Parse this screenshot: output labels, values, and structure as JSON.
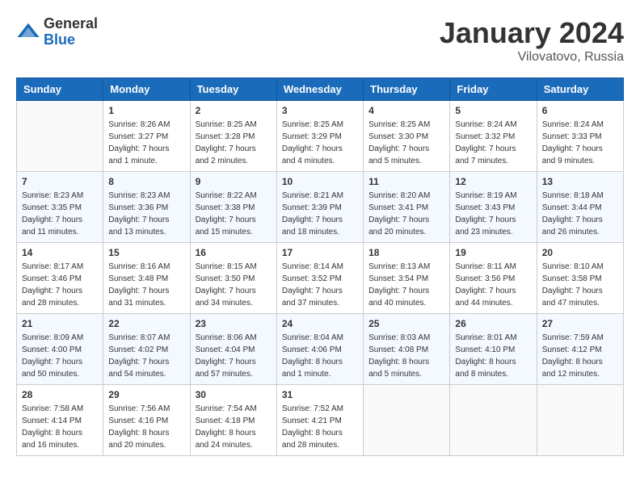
{
  "header": {
    "logo_general": "General",
    "logo_blue": "Blue",
    "month": "January 2024",
    "location": "Vilovatovo, Russia"
  },
  "weekdays": [
    "Sunday",
    "Monday",
    "Tuesday",
    "Wednesday",
    "Thursday",
    "Friday",
    "Saturday"
  ],
  "weeks": [
    [
      {
        "day": "",
        "empty": true
      },
      {
        "day": "1",
        "sunrise": "Sunrise: 8:26 AM",
        "sunset": "Sunset: 3:27 PM",
        "daylight": "Daylight: 7 hours and 1 minute."
      },
      {
        "day": "2",
        "sunrise": "Sunrise: 8:25 AM",
        "sunset": "Sunset: 3:28 PM",
        "daylight": "Daylight: 7 hours and 2 minutes."
      },
      {
        "day": "3",
        "sunrise": "Sunrise: 8:25 AM",
        "sunset": "Sunset: 3:29 PM",
        "daylight": "Daylight: 7 hours and 4 minutes."
      },
      {
        "day": "4",
        "sunrise": "Sunrise: 8:25 AM",
        "sunset": "Sunset: 3:30 PM",
        "daylight": "Daylight: 7 hours and 5 minutes."
      },
      {
        "day": "5",
        "sunrise": "Sunrise: 8:24 AM",
        "sunset": "Sunset: 3:32 PM",
        "daylight": "Daylight: 7 hours and 7 minutes."
      },
      {
        "day": "6",
        "sunrise": "Sunrise: 8:24 AM",
        "sunset": "Sunset: 3:33 PM",
        "daylight": "Daylight: 7 hours and 9 minutes."
      }
    ],
    [
      {
        "day": "7",
        "sunrise": "Sunrise: 8:23 AM",
        "sunset": "Sunset: 3:35 PM",
        "daylight": "Daylight: 7 hours and 11 minutes."
      },
      {
        "day": "8",
        "sunrise": "Sunrise: 8:23 AM",
        "sunset": "Sunset: 3:36 PM",
        "daylight": "Daylight: 7 hours and 13 minutes."
      },
      {
        "day": "9",
        "sunrise": "Sunrise: 8:22 AM",
        "sunset": "Sunset: 3:38 PM",
        "daylight": "Daylight: 7 hours and 15 minutes."
      },
      {
        "day": "10",
        "sunrise": "Sunrise: 8:21 AM",
        "sunset": "Sunset: 3:39 PM",
        "daylight": "Daylight: 7 hours and 18 minutes."
      },
      {
        "day": "11",
        "sunrise": "Sunrise: 8:20 AM",
        "sunset": "Sunset: 3:41 PM",
        "daylight": "Daylight: 7 hours and 20 minutes."
      },
      {
        "day": "12",
        "sunrise": "Sunrise: 8:19 AM",
        "sunset": "Sunset: 3:43 PM",
        "daylight": "Daylight: 7 hours and 23 minutes."
      },
      {
        "day": "13",
        "sunrise": "Sunrise: 8:18 AM",
        "sunset": "Sunset: 3:44 PM",
        "daylight": "Daylight: 7 hours and 26 minutes."
      }
    ],
    [
      {
        "day": "14",
        "sunrise": "Sunrise: 8:17 AM",
        "sunset": "Sunset: 3:46 PM",
        "daylight": "Daylight: 7 hours and 28 minutes."
      },
      {
        "day": "15",
        "sunrise": "Sunrise: 8:16 AM",
        "sunset": "Sunset: 3:48 PM",
        "daylight": "Daylight: 7 hours and 31 minutes."
      },
      {
        "day": "16",
        "sunrise": "Sunrise: 8:15 AM",
        "sunset": "Sunset: 3:50 PM",
        "daylight": "Daylight: 7 hours and 34 minutes."
      },
      {
        "day": "17",
        "sunrise": "Sunrise: 8:14 AM",
        "sunset": "Sunset: 3:52 PM",
        "daylight": "Daylight: 7 hours and 37 minutes."
      },
      {
        "day": "18",
        "sunrise": "Sunrise: 8:13 AM",
        "sunset": "Sunset: 3:54 PM",
        "daylight": "Daylight: 7 hours and 40 minutes."
      },
      {
        "day": "19",
        "sunrise": "Sunrise: 8:11 AM",
        "sunset": "Sunset: 3:56 PM",
        "daylight": "Daylight: 7 hours and 44 minutes."
      },
      {
        "day": "20",
        "sunrise": "Sunrise: 8:10 AM",
        "sunset": "Sunset: 3:58 PM",
        "daylight": "Daylight: 7 hours and 47 minutes."
      }
    ],
    [
      {
        "day": "21",
        "sunrise": "Sunrise: 8:09 AM",
        "sunset": "Sunset: 4:00 PM",
        "daylight": "Daylight: 7 hours and 50 minutes."
      },
      {
        "day": "22",
        "sunrise": "Sunrise: 8:07 AM",
        "sunset": "Sunset: 4:02 PM",
        "daylight": "Daylight: 7 hours and 54 minutes."
      },
      {
        "day": "23",
        "sunrise": "Sunrise: 8:06 AM",
        "sunset": "Sunset: 4:04 PM",
        "daylight": "Daylight: 7 hours and 57 minutes."
      },
      {
        "day": "24",
        "sunrise": "Sunrise: 8:04 AM",
        "sunset": "Sunset: 4:06 PM",
        "daylight": "Daylight: 8 hours and 1 minute."
      },
      {
        "day": "25",
        "sunrise": "Sunrise: 8:03 AM",
        "sunset": "Sunset: 4:08 PM",
        "daylight": "Daylight: 8 hours and 5 minutes."
      },
      {
        "day": "26",
        "sunrise": "Sunrise: 8:01 AM",
        "sunset": "Sunset: 4:10 PM",
        "daylight": "Daylight: 8 hours and 8 minutes."
      },
      {
        "day": "27",
        "sunrise": "Sunrise: 7:59 AM",
        "sunset": "Sunset: 4:12 PM",
        "daylight": "Daylight: 8 hours and 12 minutes."
      }
    ],
    [
      {
        "day": "28",
        "sunrise": "Sunrise: 7:58 AM",
        "sunset": "Sunset: 4:14 PM",
        "daylight": "Daylight: 8 hours and 16 minutes."
      },
      {
        "day": "29",
        "sunrise": "Sunrise: 7:56 AM",
        "sunset": "Sunset: 4:16 PM",
        "daylight": "Daylight: 8 hours and 20 minutes."
      },
      {
        "day": "30",
        "sunrise": "Sunrise: 7:54 AM",
        "sunset": "Sunset: 4:18 PM",
        "daylight": "Daylight: 8 hours and 24 minutes."
      },
      {
        "day": "31",
        "sunrise": "Sunrise: 7:52 AM",
        "sunset": "Sunset: 4:21 PM",
        "daylight": "Daylight: 8 hours and 28 minutes."
      },
      {
        "day": "",
        "empty": true
      },
      {
        "day": "",
        "empty": true
      },
      {
        "day": "",
        "empty": true
      }
    ]
  ]
}
